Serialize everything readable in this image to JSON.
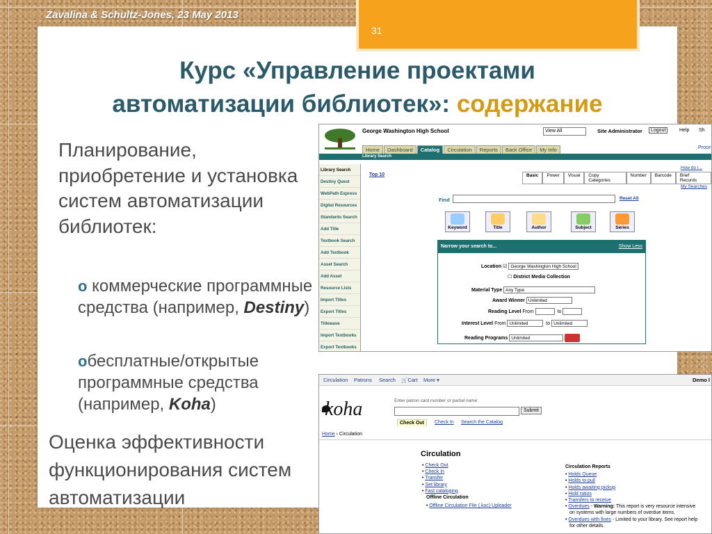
{
  "header": {
    "author_line": "Zavalina & Schultz-Jones, 23 May 2013",
    "page_number": "31"
  },
  "title": {
    "line1": "Курс «Управление проектами",
    "line2_main": "автоматизации библиотек»: ",
    "line2_highlight": "содержание"
  },
  "content": {
    "main_bullet": "Планирование, приобретение и установка систем автоматизации библиотек:",
    "sub_bullet_1": {
      "marker": "o",
      "text_before": " коммерческие программные средства (например, ",
      "product": "Destiny",
      "text_after": ")"
    },
    "sub_bullet_2": {
      "marker": "o",
      "text_before": "бесплатные/открытые программные средства (например, ",
      "product": "Koha",
      "text_after": ")"
    },
    "evaluation": "Оценка эффективности функционирования систем автоматизации"
  },
  "destiny": {
    "school": "George Washington High School",
    "view_all": "View All",
    "site_admin": "Site Administrator",
    "logout": "Logout",
    "help": "Help",
    "shop": "Sh",
    "tabs": [
      "Home",
      "Dashboard",
      "Catalog",
      "Circulation",
      "Reports",
      "Back Office",
      "My Info"
    ],
    "active_tab": "Catalog",
    "proc_link": "Proce",
    "section_label": "Library Search",
    "sidebar": [
      "Library Search",
      "Destiny Quest",
      "WebPath Express",
      "Digital Resources",
      "Standards Search",
      "Add Title",
      "Textbook Search",
      "Add Textbook",
      "Asset Search",
      "Add Asset",
      "Resource Lists",
      "Import Titles",
      "Export Titles",
      "Titlewave",
      "Import Textbooks",
      "Export Textbooks"
    ],
    "top10": "Top 10",
    "how_do_i": "How do I...",
    "search_tabs": [
      "Basic",
      "Power",
      "Visual",
      "Copy Categories",
      "Number",
      "Barcode",
      "Brief Records"
    ],
    "my_searches": "My Searches",
    "find_label": "Find",
    "reset_all": "Reset All",
    "search_buttons": [
      "Keyword",
      "Title",
      "Author",
      "Subject",
      "Series"
    ],
    "narrow": {
      "heading": "Narrow your search to...",
      "show_less": "Show Less",
      "location_label": "Location",
      "location_value": "George Washington High School",
      "district": "District Media Collection",
      "material_label": "Material Type",
      "material_value": "Any Type",
      "award_label": "Award Winner",
      "award_value": "Unlimited",
      "reading_label": "Reading Level",
      "from": "From",
      "to": "to",
      "interest_label": "Interest Level",
      "interest_from": "Unlimited",
      "interest_to": "Unlimited",
      "programs_label": "Reading Programs",
      "programs_value": "Unlimited"
    }
  },
  "koha": {
    "nav": [
      "Circulation",
      "Patrons",
      "Search",
      "Cart",
      "More ▾"
    ],
    "demo": "Demo l",
    "logo": "koha",
    "patron_hint": "Enter patron card number or partial name:",
    "submit": "Submit",
    "tabs": [
      "Check Out",
      "Check In",
      "Search the Catalog"
    ],
    "breadcrumb_home": "Home",
    "breadcrumb_current": "Circulation",
    "circ_title": "Circulation",
    "left_links": [
      "Check Out",
      "Check In",
      "Transfer",
      "Set library",
      "Fast cataloging"
    ],
    "offline_heading": "Offline Circulation",
    "offline_link": "Offline Circulation File (.koc) Uploader",
    "reports_heading": "Circulation Reports",
    "reports_links": [
      "Holds Queue",
      "Holds to pull",
      "Holds awaiting pickup",
      "Hold ratios",
      "Transfers to receive"
    ],
    "overdues": "Overdues",
    "warning": "Warning:",
    "overdues_note": "This report is very resource intensive",
    "overdues_note2": "on systems with large numbers of overdue items.",
    "overdues_fines": "Overdues with fines",
    "fines_note": "Limited to your library. See report help",
    "fines_note2": "for other details."
  },
  "colors": {
    "title": "#2b5a6a",
    "highlight": "#d39a13",
    "tab_orange": "#f6a21d",
    "destiny_green": "#1e6f6f",
    "bullet_marker": "#2b6f95"
  }
}
